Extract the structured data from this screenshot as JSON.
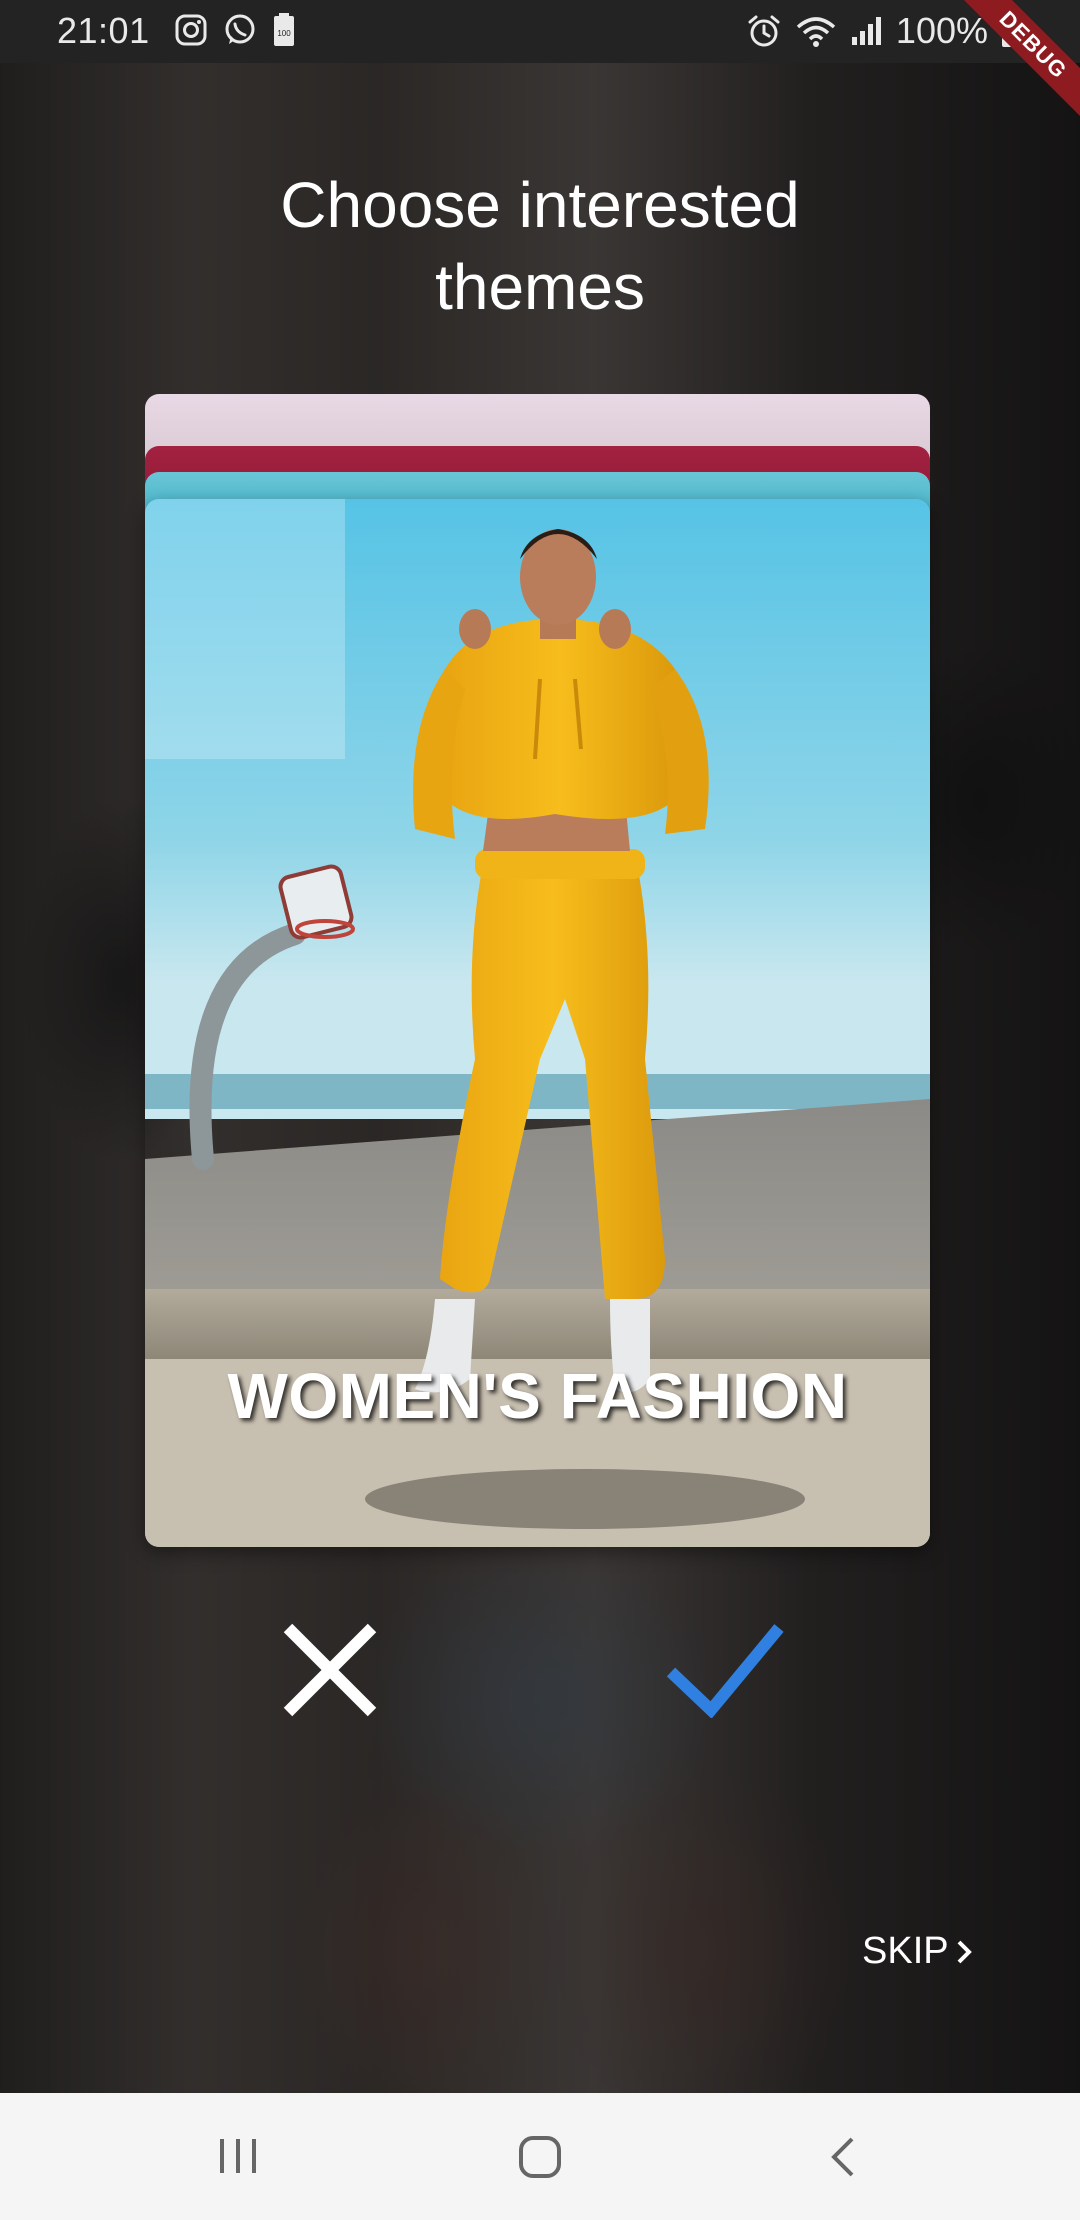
{
  "status_bar": {
    "time": "21:01",
    "left_icons": [
      "instagram-icon",
      "whatsapp-icon",
      "battery-saver-icon"
    ],
    "right_icons": [
      "alarm-icon",
      "wifi-icon",
      "signal-icon",
      "battery-icon"
    ],
    "battery": "100%"
  },
  "debug_banner": "DEBUG",
  "header": {
    "title_line1": "Choose interested",
    "title_line2": "themes"
  },
  "card": {
    "label": "WOMEN'S FASHION"
  },
  "actions": {
    "reject_icon": "close-icon",
    "accept_icon": "check-icon",
    "accent_color": "#2f80e0"
  },
  "skip": {
    "label": "SKIP"
  },
  "nav_bar": {
    "buttons": [
      "recents-icon",
      "home-icon",
      "back-icon"
    ]
  }
}
